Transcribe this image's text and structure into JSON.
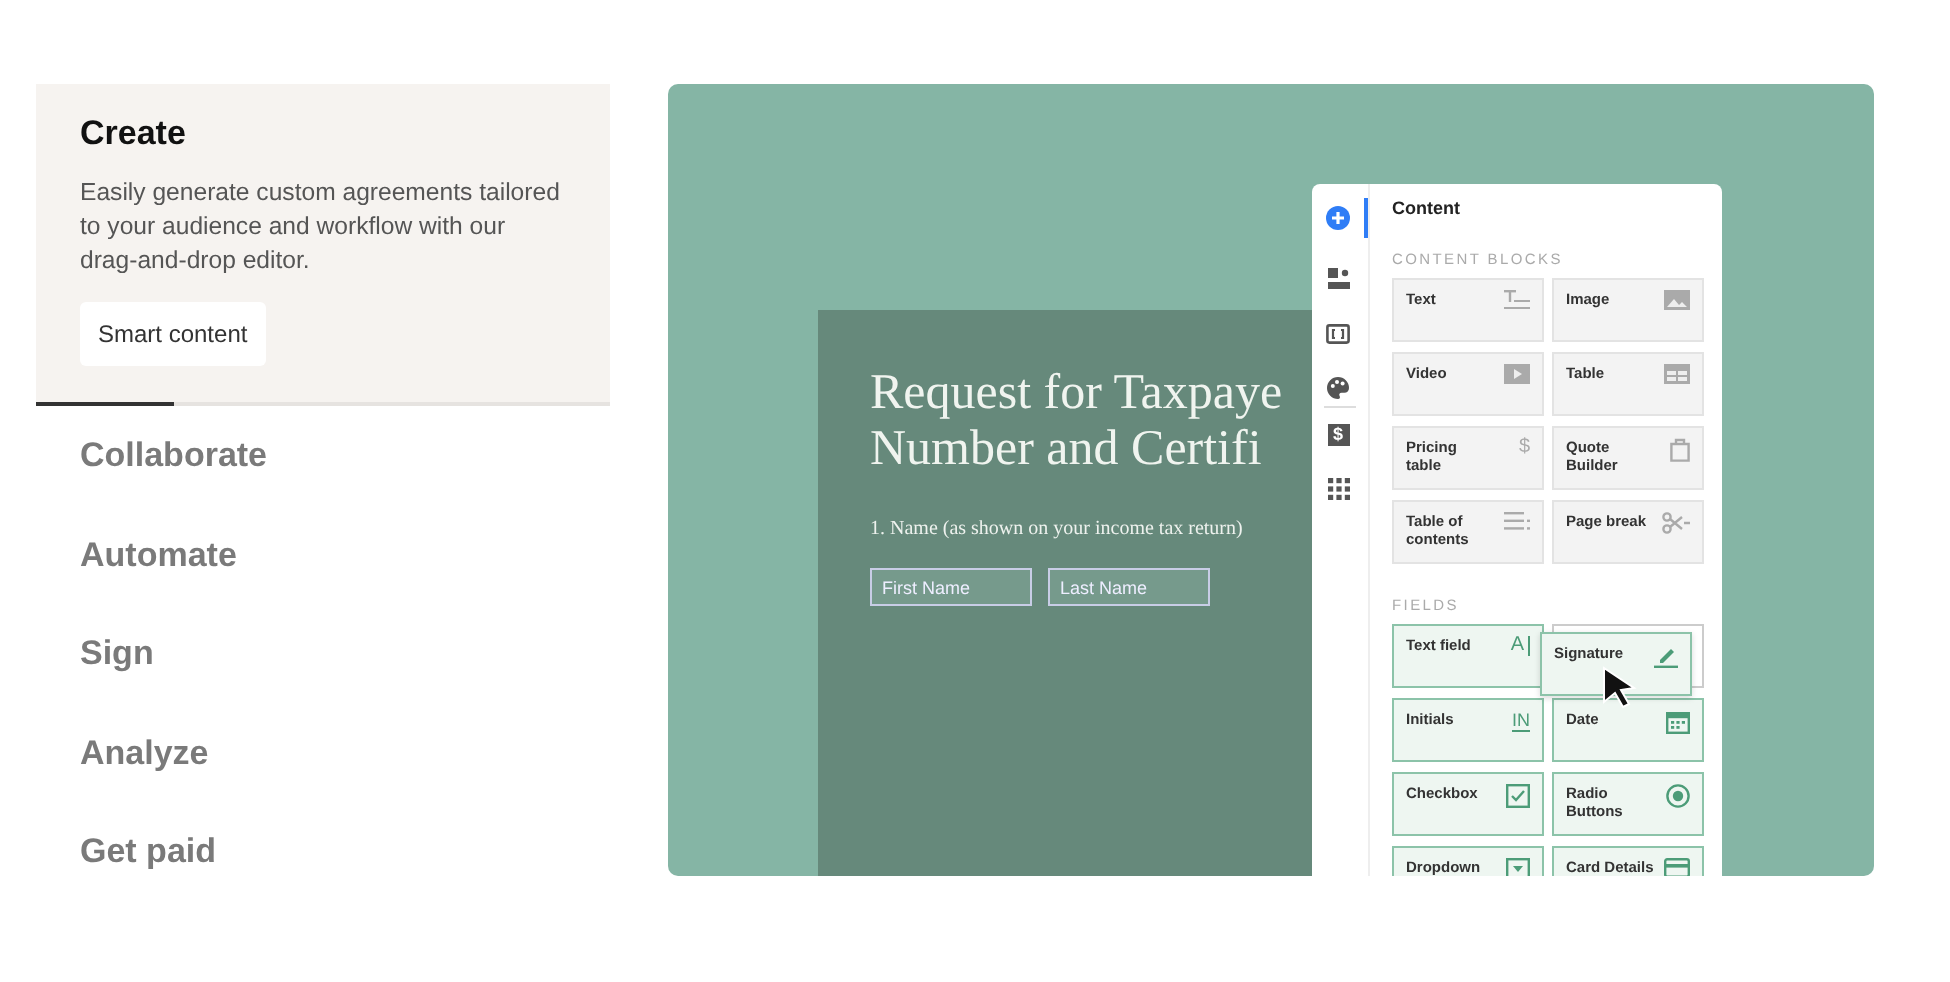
{
  "features": [
    {
      "title": "Create",
      "selected": true,
      "description": "Easily generate custom agreements tailored to your audience and workflow with our drag-and-drop editor.",
      "tag": "Smart content",
      "progress": {
        "level": 0.24
      }
    },
    {
      "title": "Collaborate",
      "selected": false
    },
    {
      "title": "Automate",
      "selected": false
    },
    {
      "title": "Sign",
      "selected": false
    },
    {
      "title": "Analyze",
      "selected": false
    },
    {
      "title": "Get paid",
      "selected": false
    }
  ],
  "preview": {
    "document": {
      "title_lines": [
        "Request for Taxpaye",
        "Number and Certifi"
      ],
      "question": "1. Name (as shown on your income tax return)",
      "fields": [
        {
          "placeholder": "First Name"
        },
        {
          "placeholder": "Last Name"
        }
      ]
    },
    "editor": {
      "rail": [
        {
          "kind": "plus",
          "selected": true
        },
        {
          "kind": "blocks",
          "selected": false
        },
        {
          "kind": "variables",
          "selected": false
        },
        {
          "kind": "palette",
          "selected": false
        },
        {
          "kind": "dollar",
          "selected": false,
          "glyph": "$"
        },
        {
          "kind": "apps",
          "selected": false
        }
      ],
      "heading": "Content",
      "sections": [
        {
          "label": "CONTENT BLOCKS",
          "kind": "block",
          "tiles": [
            {
              "label": "Text",
              "kind": "text"
            },
            {
              "label": "Image",
              "kind": "image"
            },
            {
              "label": "Video",
              "kind": "video"
            },
            {
              "label": "Table",
              "kind": "table"
            },
            {
              "label": "Pricing table",
              "kind": "pricing",
              "icon_text": "$"
            },
            {
              "label": "Quote Builder",
              "kind": "quote"
            },
            {
              "label": "Table of contents",
              "kind": "toc"
            },
            {
              "label": "Page break",
              "kind": "pagebreak"
            }
          ]
        },
        {
          "label": "FIELDS",
          "kind": "field",
          "tiles": [
            {
              "label": "Text field",
              "kind": "textfield",
              "icon_text": "A"
            },
            {
              "label": "Signature",
              "kind": "signature",
              "dragging": true
            },
            {
              "label": "Initials",
              "kind": "initials",
              "icon_text": "IN"
            },
            {
              "label": "Date",
              "kind": "date"
            },
            {
              "label": "Checkbox",
              "kind": "checkbox"
            },
            {
              "label": "Radio Buttons",
              "kind": "radio"
            },
            {
              "label": "Dropdown",
              "kind": "dropdown"
            },
            {
              "label": "Card Details",
              "kind": "card"
            }
          ]
        }
      ]
    }
  }
}
